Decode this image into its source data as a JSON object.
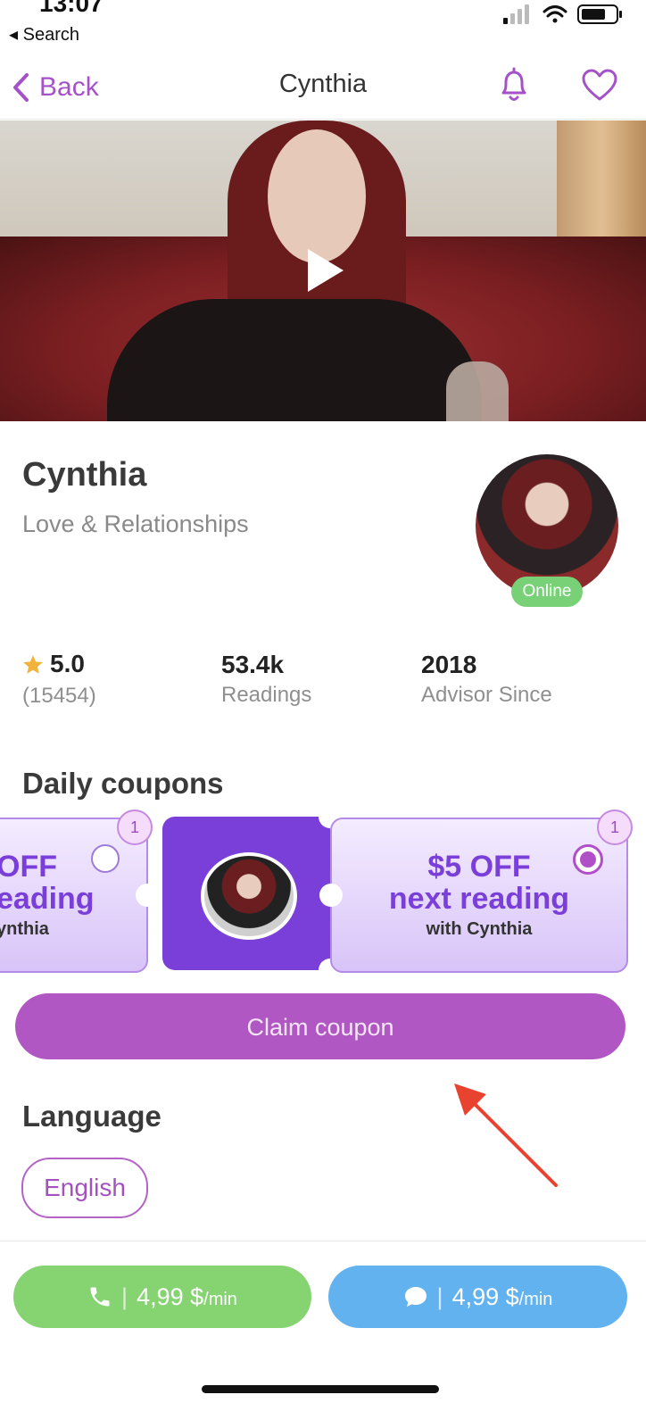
{
  "status_bar": {
    "time": "13:07",
    "back_app": "Search"
  },
  "nav": {
    "back_label": "Back",
    "title": "Cynthia",
    "accent": "#a551c7"
  },
  "video": {
    "play_icon": "play-icon"
  },
  "profile": {
    "name": "Cynthia",
    "category": "Love & Relationships",
    "status": "Online",
    "status_color": "#79d177"
  },
  "stats": {
    "rating": "5.0",
    "rating_count": "(15454)",
    "readings_value": "53.4k",
    "readings_label": "Readings",
    "since_value": "2018",
    "since_label": "Advisor Since"
  },
  "coupons": {
    "title": "Daily coupons",
    "items": [
      {
        "badge": "1",
        "line1": "OFF",
        "line2": "eading",
        "line3": "ynthia",
        "selected": false
      },
      {
        "badge": "1",
        "line1": "$5 OFF",
        "line2": "next reading",
        "line3": "with Cynthia",
        "selected": true
      }
    ],
    "claim_label": "Claim coupon",
    "claim_color": "#b157c4"
  },
  "language": {
    "title": "Language",
    "value": "English"
  },
  "actions": {
    "call_price": "4,99 $",
    "call_unit": "/min",
    "chat_price": "4,99 $",
    "chat_unit": "/min",
    "call_color": "#86d371",
    "chat_color": "#62b2ef"
  }
}
